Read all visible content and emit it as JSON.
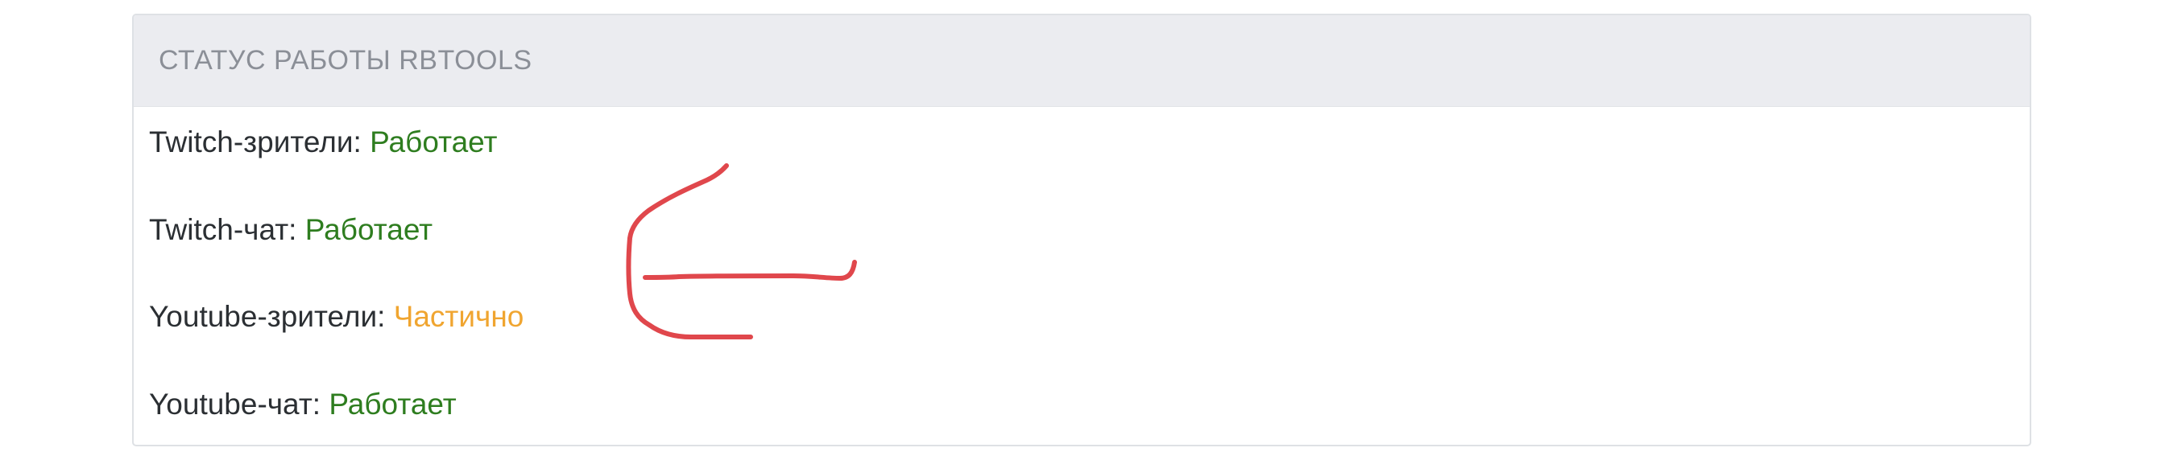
{
  "panel": {
    "title": "СТАТУС РАБОТЫ RBTOOLS"
  },
  "services": [
    {
      "label": "Twitch-зрители",
      "separator": ":",
      "status": "Работает",
      "status_color": "#2e7d1f"
    },
    {
      "label": "Twitch-чат",
      "separator": ":",
      "status": "Работает",
      "status_color": "#2e7d1f"
    },
    {
      "label": "Youtube-зрители",
      "separator": ":",
      "status": "Частично",
      "status_color": "#f0a530"
    },
    {
      "label": "Youtube-чат",
      "separator": ":",
      "status": "Работает",
      "status_color": "#2e7d1f"
    }
  ],
  "annotation": {
    "icon": "hand-drawn-arrow-icon",
    "color": "#e0474c"
  }
}
